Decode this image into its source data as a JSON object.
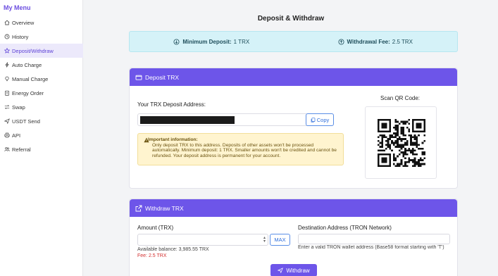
{
  "sidebar": {
    "brand": "My Menu",
    "items": [
      {
        "label": "Overview",
        "icon": "home-icon"
      },
      {
        "label": "History",
        "icon": "clock-icon"
      },
      {
        "label": "Deposit/Withdraw",
        "icon": "star-icon",
        "active": true
      },
      {
        "label": "Auto Charge",
        "icon": "lightning-icon"
      },
      {
        "label": "Manual Charge",
        "icon": "lightbulb-icon"
      },
      {
        "label": "Energy Order",
        "icon": "clipboard-icon"
      },
      {
        "label": "Swap",
        "icon": "swap-icon"
      },
      {
        "label": "USDT Send",
        "icon": "send-icon"
      },
      {
        "label": "API",
        "icon": "printer-icon"
      },
      {
        "label": "Referral",
        "icon": "users-icon"
      }
    ]
  },
  "page": {
    "title": "Deposit & Withdraw"
  },
  "info": {
    "min_deposit_label": "Minimum Deposit:",
    "min_deposit_value": "1 TRX",
    "withdrawal_fee_label": "Withdrawal Fee:",
    "withdrawal_fee_value": "2.5 TRX"
  },
  "deposit": {
    "header": "Deposit TRX",
    "address_label": "Your TRX Deposit Address:",
    "copy_label": "Copy",
    "alert_title": "Important information:",
    "alert_text": "Only deposit TRX to this address. Deposits of other assets won't be processed automatically. Minimum deposit: 1 TRX. Smaller amounts won't be credited and cannot be refunded. Your deposit address is permanent for your account.",
    "qr_label": "Scan QR Code:"
  },
  "withdraw": {
    "header": "Withdraw TRX",
    "amount_label": "Amount (TRX)",
    "max_label": "MAX",
    "available_balance": "Available balance: 3,985.55 TRX",
    "fee_text": "Fee: 2.5 TRX",
    "destination_label": "Destination Address (TRON Network)",
    "destination_hint": "Enter a valid TRON wallet address (Base58 format starting with 'T')",
    "button_label": "Withdraw"
  },
  "colors": {
    "accent": "#6d55e9",
    "info_bg": "#d5f2f8",
    "alert_bg": "#fff4cf",
    "fee_red": "#d32f2f",
    "link_blue": "#2f6fdc"
  }
}
